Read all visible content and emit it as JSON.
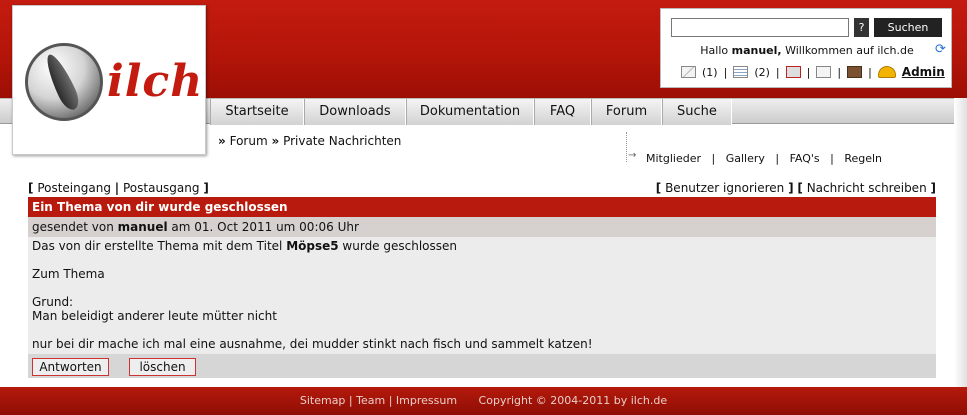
{
  "logo": {
    "text": "ilch"
  },
  "userbox": {
    "search_placeholder": "",
    "help_label": "?",
    "search_label": "Suchen",
    "greeting_pre": "Hallo ",
    "username": "manuel,",
    "greeting_post": " Willkommen auf ilch.de",
    "messages_count": "(1)",
    "list_count": "(2)",
    "admin_label": "Admin"
  },
  "nav": {
    "items": [
      "Startseite",
      "Downloads",
      "Dokumentation",
      "FAQ",
      "Forum",
      "Suche"
    ]
  },
  "breadcrumb": {
    "sep": "»",
    "forum": "Forum",
    "private": "Private Nachrichten"
  },
  "sublinks": {
    "items": [
      "Mitglieder",
      "Gallery",
      "FAQ's",
      "Regeln"
    ]
  },
  "toplinks": {
    "inbox": "Posteingang",
    "outbox": "Postausgang",
    "ignore": "Benutzer ignorieren",
    "write": "Nachricht schreiben"
  },
  "message": {
    "title": "Ein Thema von dir wurde geschlossen",
    "sent_pre": "gesendet von ",
    "sender": "manuel",
    "sent_post": " am 01. Oct 2011 um 00:06 Uhr",
    "line1_pre": "Das von dir erstellte Thema mit dem Titel ",
    "topic": "Möpse5",
    "line1_post": " wurde geschlossen",
    "link": "Zum Thema",
    "reason_label": "Grund:",
    "reason_line1": "Man beleidigt anderer leute mütter nicht",
    "reason_line2": "nur bei dir mache ich mal eine ausnahme, dei mudder stinkt nach fisch und sammelt katzen!"
  },
  "buttons": {
    "reply": "Antworten",
    "delete": "löschen"
  },
  "footer": {
    "sitemap": "Sitemap",
    "team": "Team",
    "impressum": "Impressum",
    "copyright": "Copyright © 2004-2011 by ilch.de"
  },
  "colors": {
    "brand": "#b81a0d",
    "header": "#c41b10"
  }
}
